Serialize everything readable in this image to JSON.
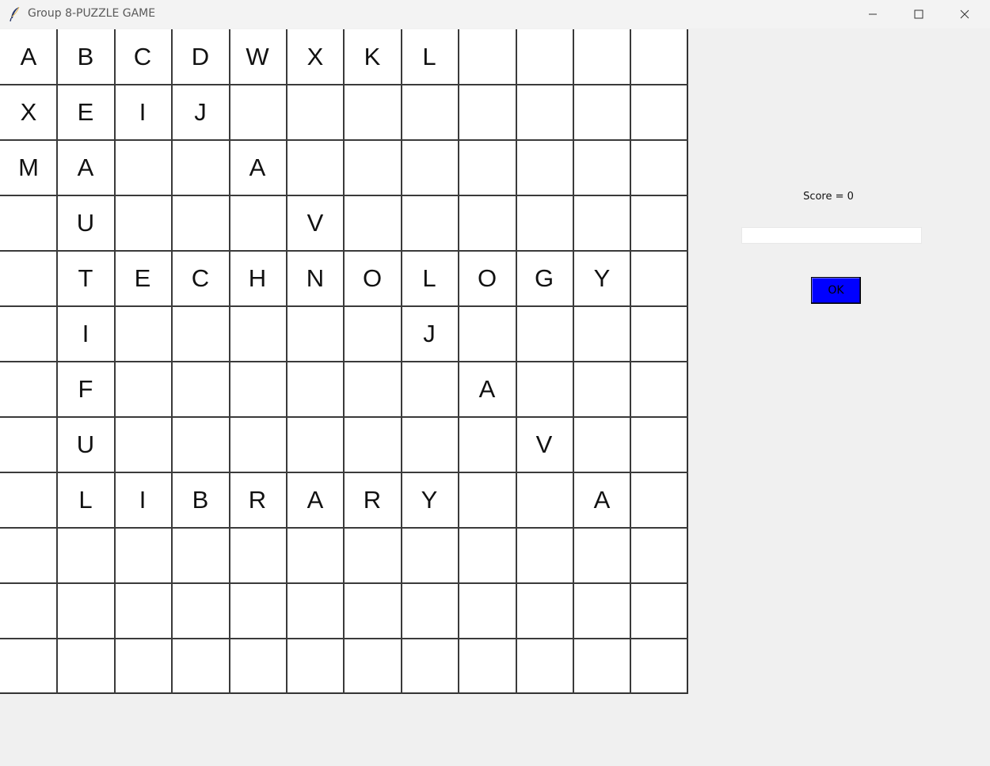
{
  "window": {
    "title": "Group 8-PUZZLE GAME",
    "icons": {
      "app": "feather-icon",
      "minimize": "minimize-icon",
      "maximize": "maximize-icon",
      "close": "close-icon"
    }
  },
  "grid": {
    "rows": 12,
    "cols": 12,
    "cells": [
      [
        "A",
        "B",
        "C",
        "D",
        "W",
        "X",
        "K",
        "L",
        "",
        "",
        "",
        ""
      ],
      [
        "X",
        "E",
        "I",
        "J",
        "",
        "",
        "",
        "",
        "",
        "",
        "",
        ""
      ],
      [
        "M",
        "A",
        "",
        "",
        "A",
        "",
        "",
        "",
        "",
        "",
        "",
        ""
      ],
      [
        "",
        "U",
        "",
        "",
        "",
        "V",
        "",
        "",
        "",
        "",
        "",
        ""
      ],
      [
        "",
        "T",
        "E",
        "C",
        "H",
        "N",
        "O",
        "L",
        "O",
        "G",
        "Y",
        ""
      ],
      [
        "",
        "I",
        "",
        "",
        "",
        "",
        "",
        "J",
        "",
        "",
        "",
        ""
      ],
      [
        "",
        "F",
        "",
        "",
        "",
        "",
        "",
        "",
        "A",
        "",
        "",
        ""
      ],
      [
        "",
        "U",
        "",
        "",
        "",
        "",
        "",
        "",
        "",
        "V",
        "",
        ""
      ],
      [
        "",
        "L",
        "I",
        "B",
        "R",
        "A",
        "R",
        "Y",
        "",
        "",
        "A",
        ""
      ],
      [
        "",
        "",
        "",
        "",
        "",
        "",
        "",
        "",
        "",
        "",
        "",
        ""
      ],
      [
        "",
        "",
        "",
        "",
        "",
        "",
        "",
        "",
        "",
        "",
        "",
        ""
      ],
      [
        "",
        "",
        "",
        "",
        "",
        "",
        "",
        "",
        "",
        "",
        "",
        ""
      ]
    ]
  },
  "panel": {
    "score_label": "Score = 0",
    "answer_value": "",
    "answer_placeholder": "",
    "ok_label": "OK",
    "ok_color": "#0000ff"
  }
}
